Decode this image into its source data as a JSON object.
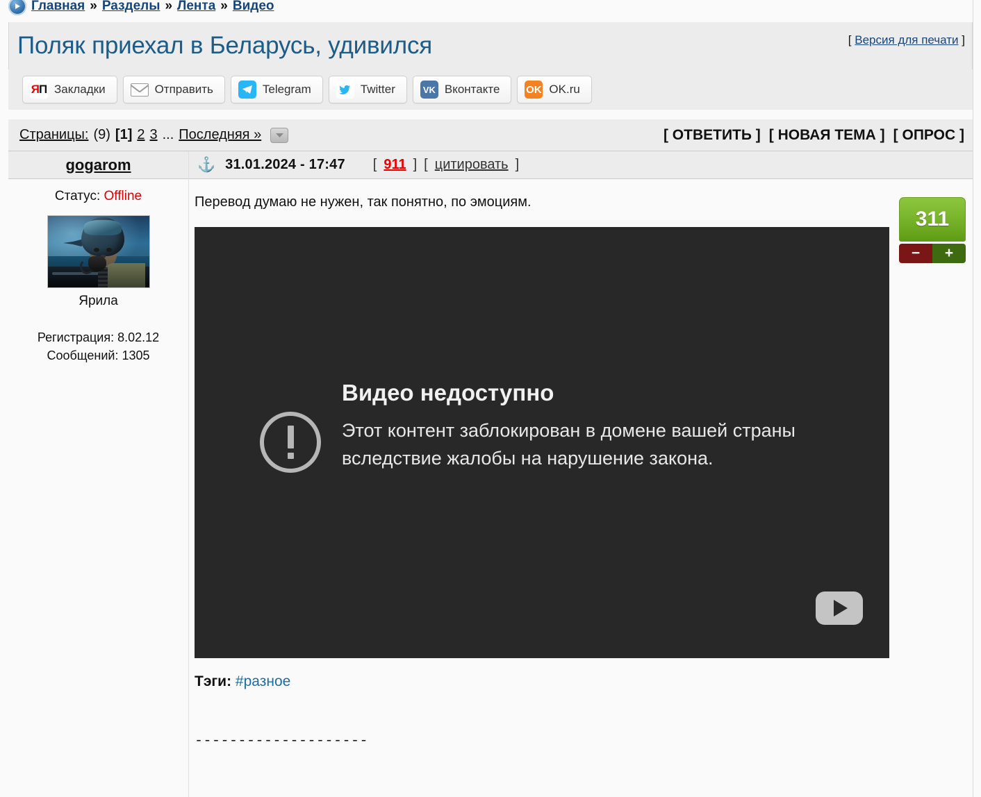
{
  "breadcrumb": {
    "icon": "play-circle-icon",
    "items": [
      "Главная",
      "Разделы",
      "Лента",
      "Видео"
    ],
    "separator": "»"
  },
  "header": {
    "title": "Поляк приехал в Беларусь, удивился",
    "print_open": "[",
    "print_label": "Версия для печати",
    "print_close": "]"
  },
  "social": [
    {
      "name": "yaplakal-bookmarks",
      "icon": "yap-icon",
      "label": "Закладки"
    },
    {
      "name": "send",
      "icon": "mail-icon",
      "label": "Отправить"
    },
    {
      "name": "telegram",
      "icon": "telegram-icon",
      "label": "Telegram"
    },
    {
      "name": "twitter",
      "icon": "twitter-icon",
      "label": "Twitter"
    },
    {
      "name": "vkontakte",
      "icon": "vk-icon",
      "label": "Вконтакте"
    },
    {
      "name": "odnoklassniki",
      "icon": "ok-icon",
      "label": "OK.ru"
    }
  ],
  "pagination": {
    "label": "Страницы:",
    "count": "(9)",
    "current": "[1]",
    "page2": "2",
    "page3": "3",
    "ellipsis": "...",
    "last": "Последняя »"
  },
  "toolbar": {
    "reply": "[ ОТВЕТИТЬ ]",
    "new_topic": "[ НОВАЯ ТЕМА ]",
    "poll": "[ ОПРОС ]"
  },
  "post": {
    "author": {
      "username": "gogarom",
      "status_label": "Статус:",
      "status_value": "Offline",
      "avatar_name": "Ярила",
      "registration": "Регистрация: 8.02.12",
      "messages": "Сообщений: 1305"
    },
    "meta": {
      "anchor_icon": "anchor-icon",
      "datetime": "31.01.2024 - 17:47",
      "bracket_open": "[",
      "post_number": "911",
      "bracket_close": "]",
      "quote_open": "[",
      "quote_label": "цитировать",
      "quote_close": "]"
    },
    "body": "Перевод думаю не нужен, так понятно, по эмоциям.",
    "video": {
      "title": "Видео недоступно",
      "message": "Этот контент заблокирован в домене вашей страны вследствие жалобы на нарушение закона.",
      "warn_icon": "exclamation-circle-icon",
      "play_icon": "play-button-icon"
    },
    "tags": {
      "label": "Тэги:",
      "items": [
        "#разное"
      ]
    },
    "signature_separator": "--------------------"
  },
  "rating": {
    "value": "311",
    "minus": "−",
    "plus": "+",
    "color_positive": "#7ab62c",
    "color_minus": "#7a1616",
    "color_plus": "#3f6b10"
  }
}
